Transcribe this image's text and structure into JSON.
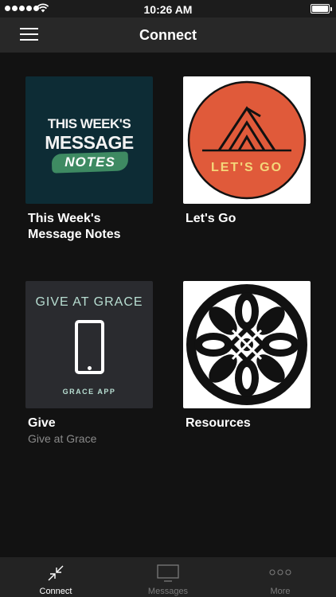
{
  "status_bar": {
    "time": "10:26 AM"
  },
  "nav": {
    "title": "Connect",
    "menu_icon": "hamburger-menu-icon"
  },
  "tiles": [
    {
      "title": "This Week's Message Notes",
      "art": {
        "line1": "THIS WEEK'S",
        "line2": "MESSAGE",
        "line3": "NOTES"
      }
    },
    {
      "title": "Let's Go",
      "art": {
        "text": "LET'S GO",
        "circle_color": "#e05a3a"
      }
    },
    {
      "title": "Give",
      "subtitle": "Give at Grace",
      "art": {
        "line1": "GIVE AT GRACE",
        "line2": "GRACE APP"
      }
    },
    {
      "title": "Resources"
    }
  ],
  "tab_bar": {
    "tabs": [
      {
        "label": "Connect",
        "icon": "connect-arrows-icon",
        "active": true
      },
      {
        "label": "Messages",
        "icon": "monitor-icon",
        "active": false
      },
      {
        "label": "More",
        "icon": "more-dots-icon",
        "active": false
      }
    ]
  },
  "colors": {
    "background": "#121212",
    "nav_bar": "#282828",
    "tab_bar": "#232323",
    "subtitle": "#8a8a8a"
  }
}
